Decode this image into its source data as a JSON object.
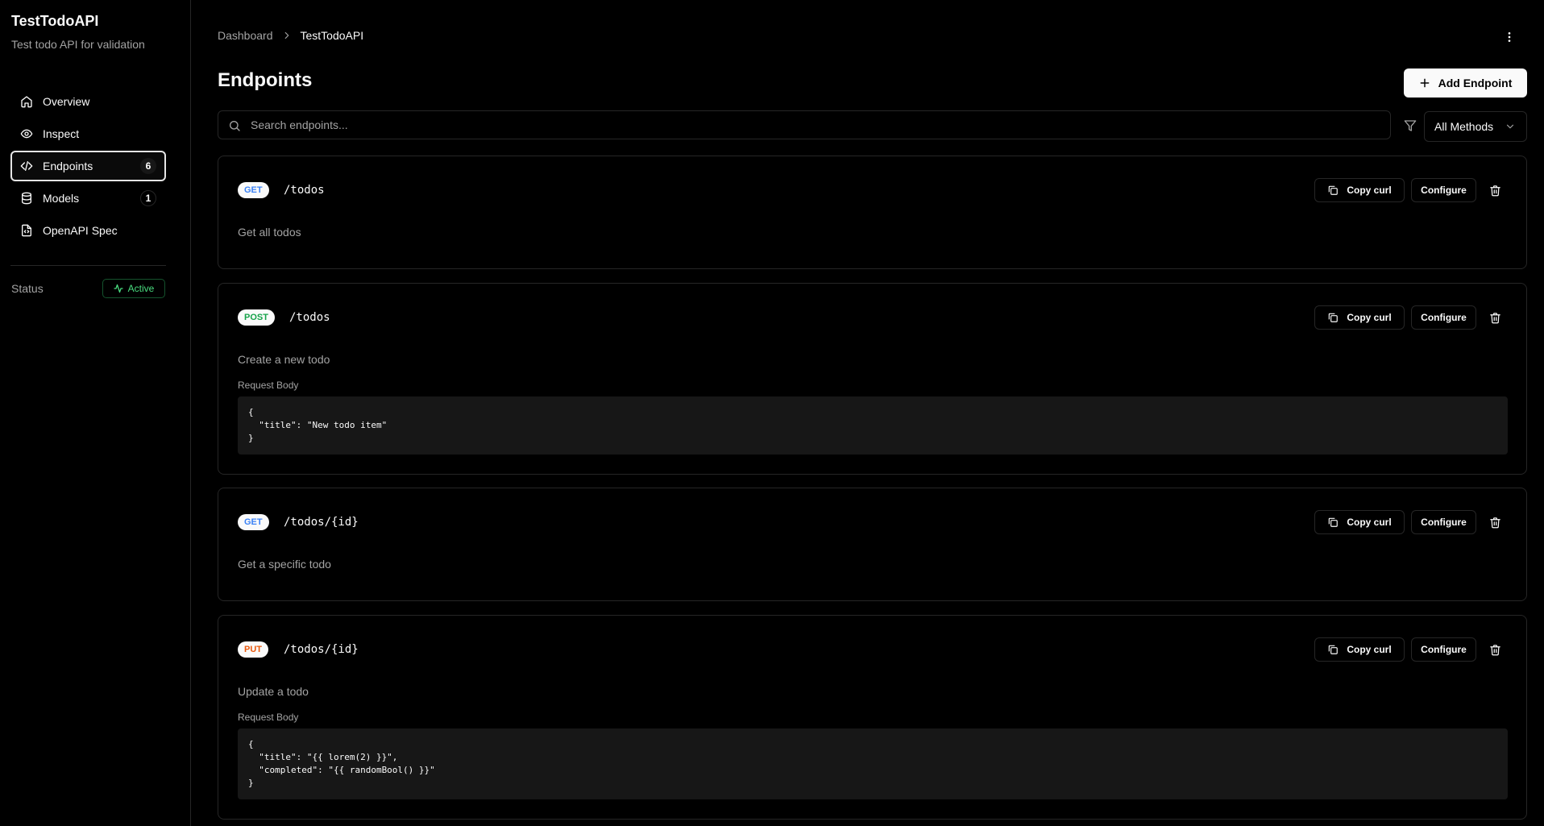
{
  "app": {
    "title": "TestTodoAPI",
    "description": "Test todo API for validation"
  },
  "sidebar": {
    "items": [
      {
        "label": "Overview",
        "icon": "home-icon"
      },
      {
        "label": "Inspect",
        "icon": "eye-icon"
      },
      {
        "label": "Endpoints",
        "icon": "code-icon",
        "badge": "6"
      },
      {
        "label": "Models",
        "icon": "database-icon",
        "badge": "1"
      },
      {
        "label": "OpenAPI Spec",
        "icon": "file-code-icon"
      }
    ],
    "status_label": "Status",
    "status_value": "Active"
  },
  "header": {
    "breadcrumb_root": "Dashboard",
    "breadcrumb_current": "TestTodoAPI",
    "page_title": "Endpoints",
    "add_button": "Add Endpoint"
  },
  "search": {
    "placeholder": "Search endpoints...",
    "value": ""
  },
  "filter": {
    "selected": "All Methods"
  },
  "endpoint_actions": {
    "copy": "Copy curl",
    "configure": "Configure"
  },
  "endpoints": [
    {
      "method": "GET",
      "path": "/todos",
      "description": "Get all todos"
    },
    {
      "method": "POST",
      "path": "/todos",
      "description": "Create a new todo",
      "body_label": "Request Body",
      "body": "{\n  \"title\": \"New todo item\"\n}"
    },
    {
      "method": "GET",
      "path": "/todos/{id}",
      "description": "Get a specific todo"
    },
    {
      "method": "PUT",
      "path": "/todos/{id}",
      "description": "Update a todo",
      "body_label": "Request Body",
      "body": "{\n  \"title\": \"{{ lorem(2) }}\",\n  \"completed\": \"{{ randomBool() }}\"\n}"
    }
  ],
  "colors": {
    "get": "#3b82f6",
    "post": "#16a34a",
    "put": "#ea580c",
    "active_status": "#4ade80"
  }
}
